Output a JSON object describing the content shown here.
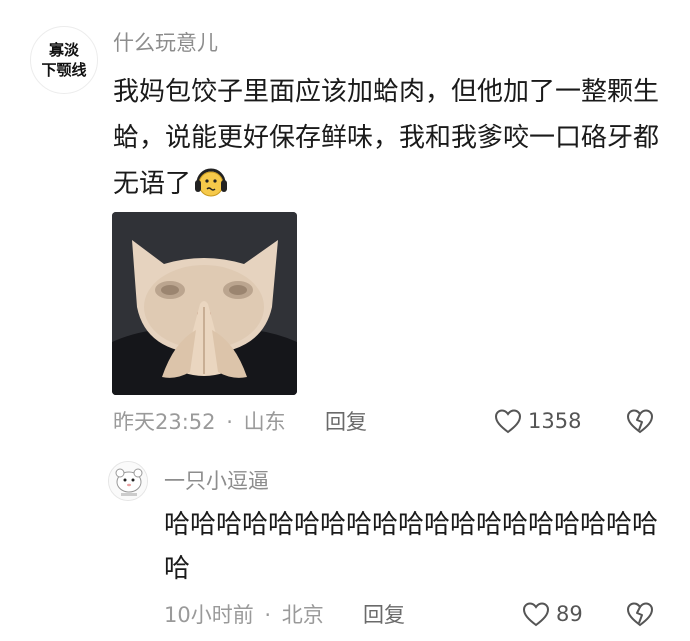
{
  "comment": {
    "avatar_lines": [
      "寡淡",
      "下颚线"
    ],
    "username": "什么玩意儿",
    "text": "我妈包饺子里面应该加蛤肉，但他加了一整颗生蛤，说能更好保存鲜味，我和我爹咬一口硌牙都无语了",
    "emoji": "speechless-face-with-headphones",
    "sticker": "cat-hands-pressed-together",
    "time": "昨天23:52",
    "separator": "·",
    "location": "山东",
    "reply_label": "回复",
    "likes": "1358"
  },
  "reply": {
    "username": "一只小逗逼",
    "text": "哈哈哈哈哈哈哈哈哈哈哈哈哈哈哈哈哈哈哈哈",
    "time": "10小时前",
    "separator": "·",
    "location": "北京",
    "reply_label": "回复",
    "likes": "89"
  },
  "colors": {
    "meta": "#9a9a9a",
    "username": "#8d8d8d",
    "text": "#1a1a1a",
    "emoji_yellow": "#f6c94a"
  }
}
